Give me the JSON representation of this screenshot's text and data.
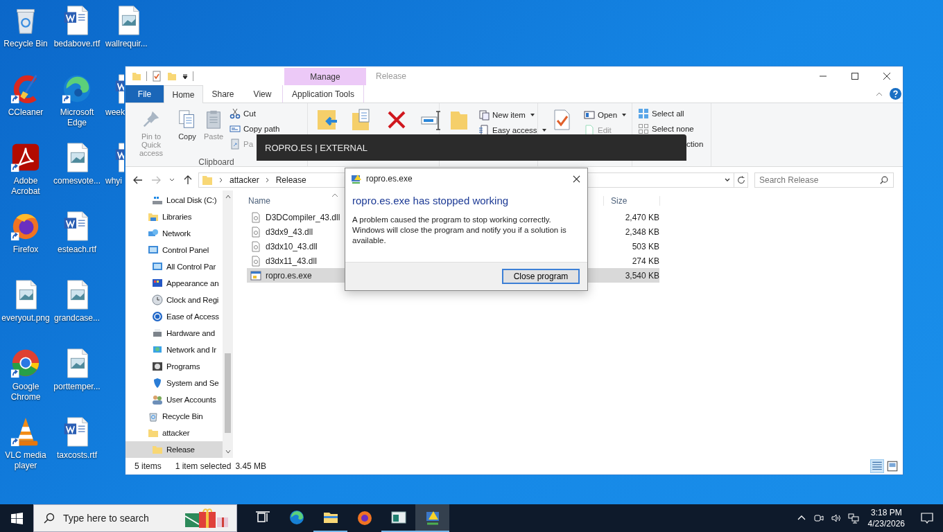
{
  "desktop": {
    "columns": [
      [
        {
          "label": "Recycle Bin",
          "kind": "recycle",
          "shortcut": false
        },
        {
          "label": "CCleaner",
          "kind": "ccleaner",
          "shortcut": true
        },
        {
          "label": "Adobe Acrobat",
          "kind": "acrobat",
          "shortcut": true
        },
        {
          "label": "Firefox",
          "kind": "firefox",
          "shortcut": true
        },
        {
          "label": "everyout.png",
          "kind": "image",
          "shortcut": false
        },
        {
          "label": "Google Chrome",
          "kind": "chrome",
          "shortcut": true
        },
        {
          "label": "VLC media player",
          "kind": "vlc",
          "shortcut": true
        }
      ],
      [
        {
          "label": "bedabove.rtf",
          "kind": "word",
          "shortcut": false
        },
        {
          "label": "Microsoft Edge",
          "kind": "edge",
          "shortcut": true
        },
        {
          "label": "comesvote...",
          "kind": "image",
          "shortcut": false
        },
        {
          "label": "esteach.rtf",
          "kind": "word",
          "shortcut": false
        },
        {
          "label": "grandcase...",
          "kind": "image",
          "shortcut": false
        },
        {
          "label": "porttemper...",
          "kind": "image",
          "shortcut": false
        },
        {
          "label": "taxcosts.rtf",
          "kind": "word",
          "shortcut": false
        }
      ],
      [
        {
          "label": "wallrequir...",
          "kind": "image",
          "shortcut": false
        },
        {
          "label": "week",
          "kind": "word",
          "shortcut": false
        },
        {
          "label": "whyi",
          "kind": "word",
          "shortcut": false
        }
      ]
    ]
  },
  "window": {
    "title": "Release",
    "context_header": "Manage",
    "tabs": [
      {
        "label": "File",
        "kind": "file",
        "selected": false
      },
      {
        "label": "Home",
        "kind": "tab",
        "selected": true
      },
      {
        "label": "Share",
        "kind": "tab",
        "selected": false
      },
      {
        "label": "View",
        "kind": "tab",
        "selected": false
      },
      {
        "label": "Application Tools",
        "kind": "context",
        "selected": false
      }
    ],
    "ribbon": {
      "clipboard": {
        "label": "Clipboard",
        "large": [
          {
            "label": "Pin to Quick access",
            "kind": "pin",
            "disabled": true
          },
          {
            "label": "Copy",
            "kind": "copy",
            "disabled": false
          },
          {
            "label": "Paste",
            "kind": "paste",
            "disabled": true
          }
        ],
        "small": [
          {
            "label": "Cut",
            "kind": "cut",
            "disabled": false
          },
          {
            "label": "Copy path",
            "kind": "copypath",
            "disabled": false
          },
          {
            "label": "Pa",
            "kind": "shortcut",
            "disabled": true
          }
        ]
      },
      "organize": [
        {
          "kind": "moveto"
        },
        {
          "kind": "copyto"
        },
        {
          "kind": "delete"
        },
        {
          "kind": "rename"
        }
      ],
      "new": {
        "small": [
          {
            "label": "New item",
            "kind": "newitem",
            "dropdown": true
          },
          {
            "label": "Easy access",
            "kind": "easy",
            "dropdown": true
          }
        ]
      },
      "open": {
        "small": [
          {
            "label": "Open",
            "kind": "open",
            "dropdown": true,
            "disabled": false
          },
          {
            "label": "Edit",
            "kind": "edit",
            "dropdown": false,
            "disabled": true
          }
        ]
      },
      "select": {
        "small": [
          {
            "label": "Select all",
            "kind": "all"
          },
          {
            "label": "Select none",
            "kind": "none"
          },
          {
            "label": "ction",
            "kind": "partial"
          }
        ]
      }
    },
    "address": {
      "path": [
        "attacker",
        "Release"
      ],
      "search_placeholder": "Search Release"
    },
    "nav": {
      "continued": [
        {
          "label": "Local Disk (C:)",
          "kind": "drive",
          "selected": false
        }
      ],
      "items": [
        {
          "label": "Libraries",
          "kind": "libraries",
          "selected": false
        },
        {
          "label": "Network",
          "kind": "network",
          "selected": false
        },
        {
          "label": "Control Panel",
          "kind": "control",
          "selected": false,
          "children": [
            {
              "label": "All Control Par",
              "kind": "control",
              "selected": false
            },
            {
              "label": "Appearance an",
              "kind": "appearance",
              "selected": false
            },
            {
              "label": "Clock and Regi",
              "kind": "clock",
              "selected": false
            },
            {
              "label": "Ease of Access",
              "kind": "ease",
              "selected": false
            },
            {
              "label": "Hardware and",
              "kind": "hardware",
              "selected": false
            },
            {
              "label": "Network and Ir",
              "kind": "globe",
              "selected": false
            },
            {
              "label": "Programs",
              "kind": "programs",
              "selected": false
            },
            {
              "label": "System and Se",
              "kind": "system",
              "selected": false
            },
            {
              "label": "User Accounts",
              "kind": "users",
              "selected": false
            }
          ]
        },
        {
          "label": "Recycle Bin",
          "kind": "recycle",
          "selected": false
        },
        {
          "label": "attacker",
          "kind": "folder",
          "selected": false,
          "children": [
            {
              "label": "Release",
              "kind": "folder",
              "selected": true
            }
          ]
        }
      ]
    },
    "files": {
      "columns": [
        "Name",
        "Size"
      ],
      "rows": [
        {
          "name": "D3DCompiler_43.dll",
          "size": "2,470 KB",
          "kind": "dll",
          "selected": false
        },
        {
          "name": "d3dx9_43.dll",
          "size": "2,348 KB",
          "kind": "dll",
          "selected": false
        },
        {
          "name": "d3dx10_43.dll",
          "size": "503 KB",
          "kind": "dll",
          "selected": false
        },
        {
          "name": "d3dx11_43.dll",
          "size": "274 KB",
          "kind": "dll",
          "selected": false
        },
        {
          "name": "ropro.es.exe",
          "size": "3,540 KB",
          "kind": "exe",
          "selected": true
        }
      ]
    },
    "status": {
      "count": "5 items",
      "selection": "1 item selected",
      "size": "3.45 MB"
    }
  },
  "banner": {
    "text": "ROPRO.ES | EXTERNAL"
  },
  "dialog": {
    "title": "ropro.es.exe",
    "heading": "ropro.es.exe has stopped working",
    "message": "A problem caused the program to stop working correctly. Windows will close the program and notify you if a solution is available.",
    "button": "Close program"
  },
  "taskbar": {
    "search_placeholder": "Type here to search",
    "apps": [
      {
        "kind": "taskview",
        "running": false,
        "selected": false
      },
      {
        "kind": "edge",
        "running": false,
        "selected": false
      },
      {
        "kind": "explorer",
        "running": true,
        "selected": false
      },
      {
        "kind": "firefox",
        "running": false,
        "selected": false
      },
      {
        "kind": "window-app",
        "running": true,
        "selected": false
      },
      {
        "kind": "error-app",
        "running": true,
        "selected": true
      }
    ],
    "time": "3:18 PM",
    "date": "4/23/2026"
  }
}
